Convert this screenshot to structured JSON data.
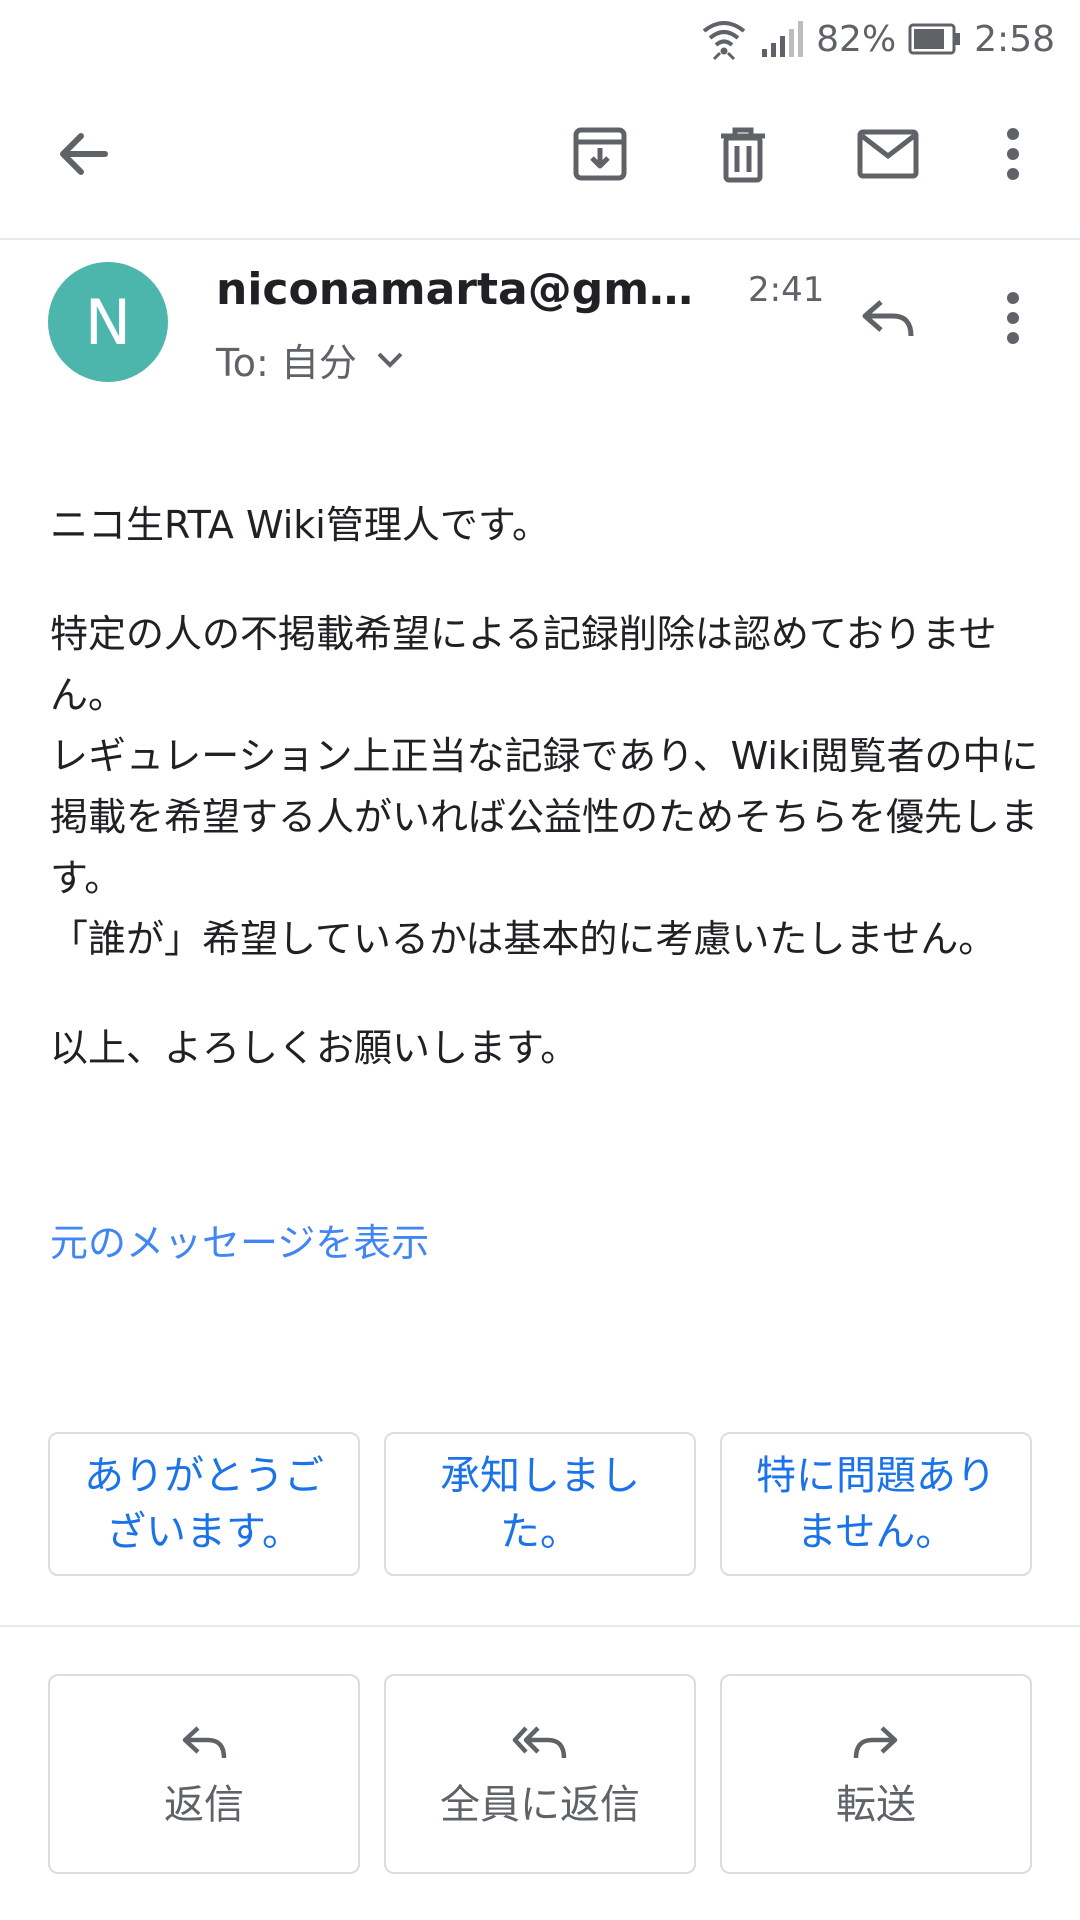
{
  "status_bar": {
    "battery": "82%",
    "time": "2:58"
  },
  "toolbar": {
    "back_icon": "arrow-left-icon",
    "archive_icon": "archive-icon",
    "delete_icon": "trash-icon",
    "unread_icon": "mail-icon",
    "more_icon": "more-vert-icon"
  },
  "message": {
    "avatar_letter": "N",
    "avatar_color": "#4db6ac",
    "sender": "niconamarta@gmail.com",
    "time": "2:41",
    "recipient": "To: 自分",
    "body": [
      "ニコ生RTA Wiki管理人です。",
      "特定の人の不掲載希望による記録削除は認めておりません。\nレギュレーション上正当な記録であり、Wiki閲覧者の中に掲載を希望する人がいれば公益性のためそちらを優先します。\n「誰が」希望しているかは基本的に考慮いたしません。",
      "以上、よろしくお願いします。"
    ],
    "show_original": "元のメッセージを表示"
  },
  "smart_replies": [
    "ありがとうございます。",
    "承知しました。",
    "特に問題ありません。"
  ],
  "actions": {
    "reply": "返信",
    "reply_all": "全員に返信",
    "forward": "転送"
  },
  "colors": {
    "link": "#4285f4",
    "chip_text": "#1a73e8",
    "icon": "#5f6368"
  }
}
